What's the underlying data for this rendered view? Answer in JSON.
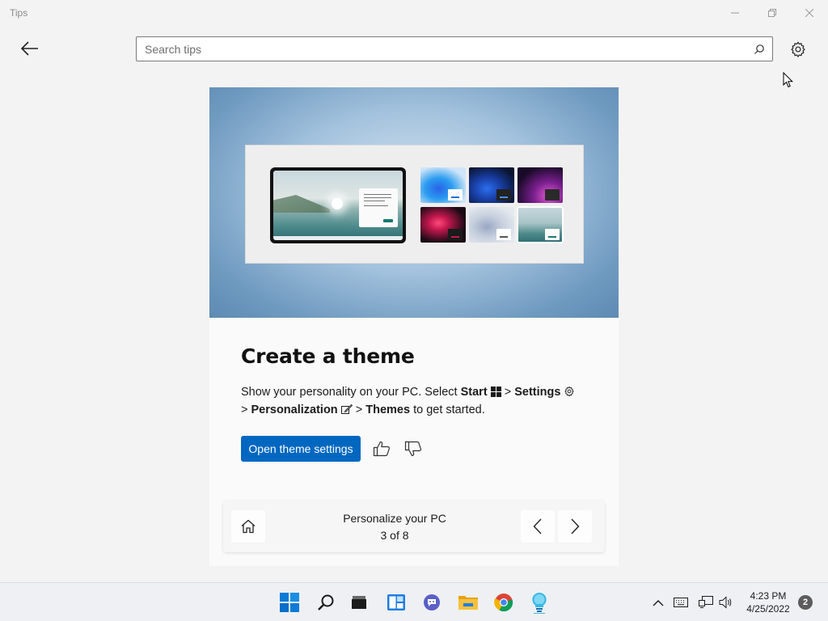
{
  "window": {
    "title": "Tips"
  },
  "header": {
    "search_placeholder": "Search tips"
  },
  "tip": {
    "title": "Create a theme",
    "desc_prefix": "Show your personality on your PC. Select ",
    "start_label": "Start",
    "sep1": " > ",
    "settings_label": "Settings",
    "sep2": "> ",
    "personalization_label": "Personalization",
    "sep3": " > ",
    "themes_label": "Themes",
    "desc_suffix": " to get started.",
    "action_label": "Open theme settings"
  },
  "nav": {
    "title": "Personalize your PC",
    "count": "3 of 8"
  },
  "taskbar": {
    "apps": [
      "start",
      "search",
      "task-view",
      "widgets",
      "teams-chat",
      "file-explorer",
      "chrome",
      "tips"
    ],
    "time": "4:23 PM",
    "date": "4/25/2022",
    "notification_count": "2"
  },
  "colors": {
    "accent": "#0067c0",
    "background": "#f3f3f3",
    "taskbar": "#eef0f3"
  }
}
